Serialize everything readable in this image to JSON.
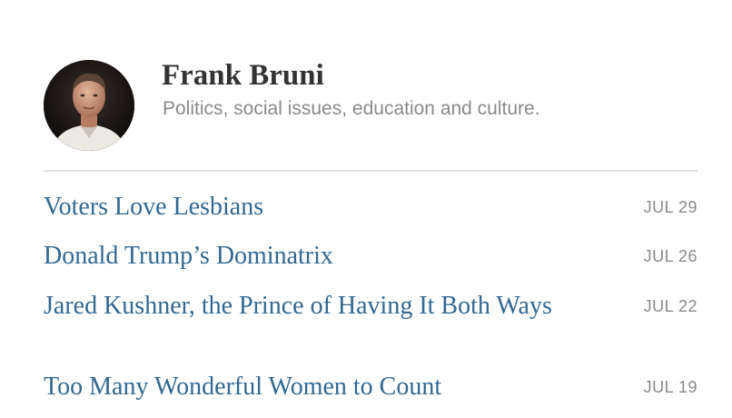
{
  "author": {
    "name": "Frank Bruni",
    "description": "Politics, social issues, education and culture."
  },
  "stories": [
    {
      "title": "Voters Love Lesbians",
      "date": "JUL 29"
    },
    {
      "title": "Donald Trump’s Dominatrix",
      "date": "JUL 26"
    },
    {
      "title": "Jared Kushner, the Prince of Having It Both Ways",
      "date": "JUL 22"
    },
    {
      "title": "Too Many Wonderful Women to Count",
      "date": "JUL 19"
    }
  ],
  "colors": {
    "link": "#326891",
    "muted": "#8a8a8a",
    "name": "#333333",
    "divider": "#e2e2e2"
  }
}
